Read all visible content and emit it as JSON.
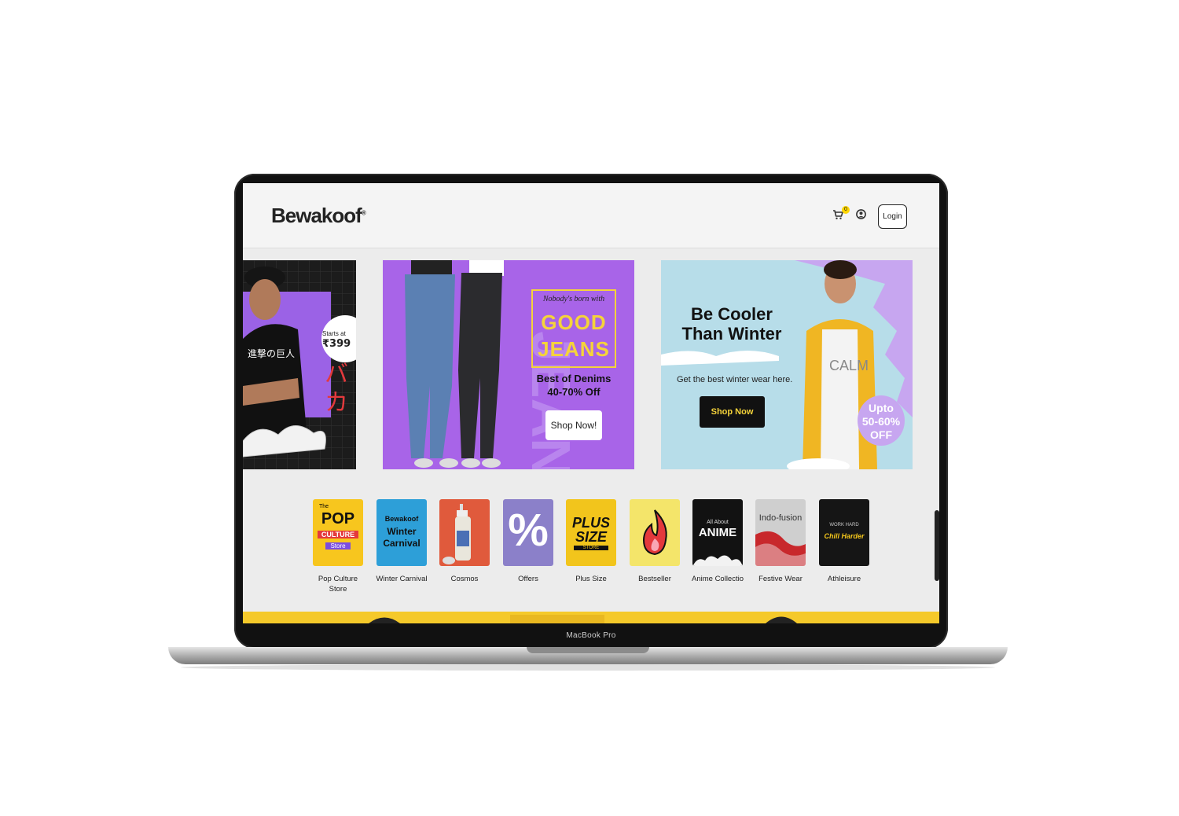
{
  "device": {
    "label": "MacBook Pro"
  },
  "header": {
    "logo": "Bewakoof",
    "logo_mark": "®",
    "cart_count": "0",
    "login_label": "Login"
  },
  "banners": {
    "anime": {
      "starts_at": "Starts at",
      "price": "₹399",
      "jp_text": "バカ",
      "tee_text": "進撃の巨人"
    },
    "jeans": {
      "tagline": "Nobody's born with",
      "headline_1": "GOOD",
      "headline_2": "JEANS",
      "sub_1": "Best of Denims",
      "sub_2": "40-70% Off",
      "cta": "Shop Now!"
    },
    "winter": {
      "headline_1": "Be Cooler",
      "headline_2": "Than Winter",
      "sub": "Get the best winter wear here.",
      "cta": "Shop Now",
      "badge_1": "Upto",
      "badge_2": "50-60%",
      "badge_3": "OFF"
    }
  },
  "categories": [
    {
      "label": "Pop Culture Store",
      "tile": [
        "The",
        "POP",
        "CULTURE",
        "Store"
      ]
    },
    {
      "label": "Winter Carnival",
      "tile": [
        "Bewakoof",
        "Winter",
        "Carnival"
      ]
    },
    {
      "label": "Cosmos",
      "tile": []
    },
    {
      "label": "Offers",
      "tile": [
        "%"
      ]
    },
    {
      "label": "Plus Size",
      "tile": [
        "PLUS",
        "SIZE",
        "STORE"
      ]
    },
    {
      "label": "Bestseller",
      "tile": []
    },
    {
      "label": "Anime Collectio",
      "tile": [
        "All About",
        "ANIME"
      ]
    },
    {
      "label": "Festive Wear",
      "tile": [
        "Indo-fusion"
      ]
    },
    {
      "label": "Athleisure",
      "tile": [
        "WORK HARD",
        "Chill Harder"
      ]
    }
  ],
  "colors": {
    "accent_yellow": "#ffd600",
    "jeans_purple": "#a864e8",
    "winter_blue": "#b7dde9"
  },
  "icons": [
    "cart-icon",
    "user-icon"
  ]
}
